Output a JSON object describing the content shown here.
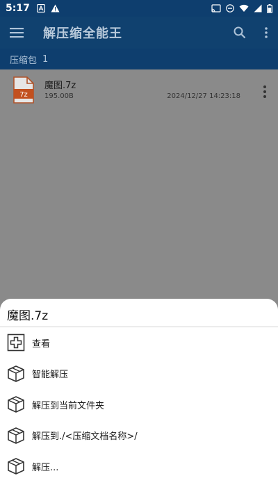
{
  "status_bar": {
    "time": "5:17"
  },
  "app_bar": {
    "title": "解压缩全能王"
  },
  "sub_header": {
    "label": "压缩包",
    "count": "1"
  },
  "files": [
    {
      "name": "魔图.7z",
      "size": "195.00B",
      "date": "2024/12/27 14:23:18",
      "icon_text": "7z"
    }
  ],
  "sheet": {
    "title": "魔图.7z",
    "items": [
      {
        "label": "查看",
        "icon": "plus-box-icon"
      },
      {
        "label": "智能解压",
        "icon": "package-icon"
      },
      {
        "label": "解压到当前文件夹",
        "icon": "package-icon"
      },
      {
        "label": "解压到./<压缩文档名称>/",
        "icon": "package-icon"
      },
      {
        "label": "解压...",
        "icon": "package-icon"
      }
    ]
  },
  "colors": {
    "primary": "#0e3e6e",
    "scrim": "#8a8a8a",
    "file_icon": "#d0541b"
  }
}
